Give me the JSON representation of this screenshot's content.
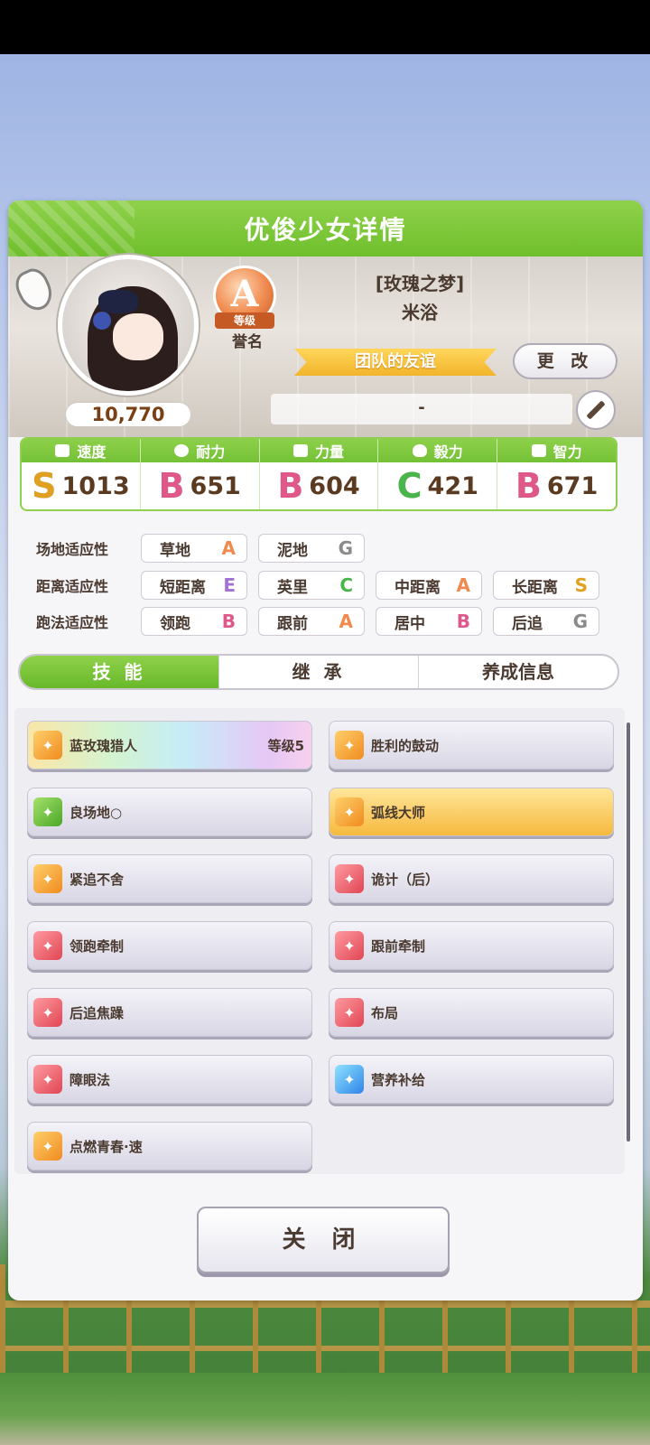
{
  "dialog": {
    "title": "优俊少女详情"
  },
  "profile": {
    "fans": "10,770",
    "rank_grade": "A",
    "rank_ribbon": "等级",
    "rank_label": "誉名",
    "title": "[玫瑰之梦]",
    "name": "米浴",
    "team_banner": "团队的友谊",
    "change_label": "更 改",
    "motto": "-"
  },
  "stats": [
    {
      "label": "速度",
      "grade": "S",
      "grade_color": "#e0a020",
      "value": "1013"
    },
    {
      "label": "耐力",
      "grade": "B",
      "grade_color": "#e0588a",
      "value": "651"
    },
    {
      "label": "力量",
      "grade": "B",
      "grade_color": "#e0588a",
      "value": "604"
    },
    {
      "label": "毅力",
      "grade": "C",
      "grade_color": "#49b54a",
      "value": "421"
    },
    {
      "label": "智力",
      "grade": "B",
      "grade_color": "#e0588a",
      "value": "671"
    }
  ],
  "aptitude": {
    "track": {
      "label": "场地适应性",
      "items": [
        {
          "name": "草地",
          "grade": "A",
          "color": "#f08a4e"
        },
        {
          "name": "泥地",
          "grade": "G",
          "color": "#8a8a8a"
        }
      ]
    },
    "distance": {
      "label": "距离适应性",
      "items": [
        {
          "name": "短距离",
          "grade": "E",
          "color": "#a271d6"
        },
        {
          "name": "英里",
          "grade": "C",
          "color": "#49b54a"
        },
        {
          "name": "中距离",
          "grade": "A",
          "color": "#f08a4e"
        },
        {
          "name": "长距离",
          "grade": "S",
          "color": "#e0a020"
        }
      ]
    },
    "style": {
      "label": "跑法适应性",
      "items": [
        {
          "name": "领跑",
          "grade": "B",
          "color": "#e0588a"
        },
        {
          "name": "跟前",
          "grade": "A",
          "color": "#f08a4e"
        },
        {
          "name": "居中",
          "grade": "B",
          "color": "#e0588a"
        },
        {
          "name": "后追",
          "grade": "G",
          "color": "#8a8a8a"
        }
      ]
    }
  },
  "tabs": [
    "技 能",
    "继 承",
    "养成信息"
  ],
  "skills": [
    {
      "name": "蓝玫瑰猎人",
      "level": "等级5",
      "icon": "orange"
    },
    {
      "name": "胜利的鼓动",
      "level": "",
      "icon": "orange"
    },
    {
      "name": "良场地○",
      "level": "",
      "icon": "green"
    },
    {
      "name": "弧线大师",
      "level": "",
      "icon": "orange"
    },
    {
      "name": "紧追不舍",
      "level": "",
      "icon": "orange"
    },
    {
      "name": "诡计（后）",
      "level": "",
      "icon": "red"
    },
    {
      "name": "领跑牵制",
      "level": "",
      "icon": "red"
    },
    {
      "name": "跟前牵制",
      "level": "",
      "icon": "red"
    },
    {
      "name": "后追焦躁",
      "level": "",
      "icon": "red"
    },
    {
      "name": "布局",
      "level": "",
      "icon": "red"
    },
    {
      "name": "障眼法",
      "level": "",
      "icon": "red"
    },
    {
      "name": "营养补给",
      "level": "",
      "icon": "blue"
    },
    {
      "name": "点燃青春·速",
      "level": "",
      "icon": "orange"
    }
  ],
  "close_label": "关 闭"
}
